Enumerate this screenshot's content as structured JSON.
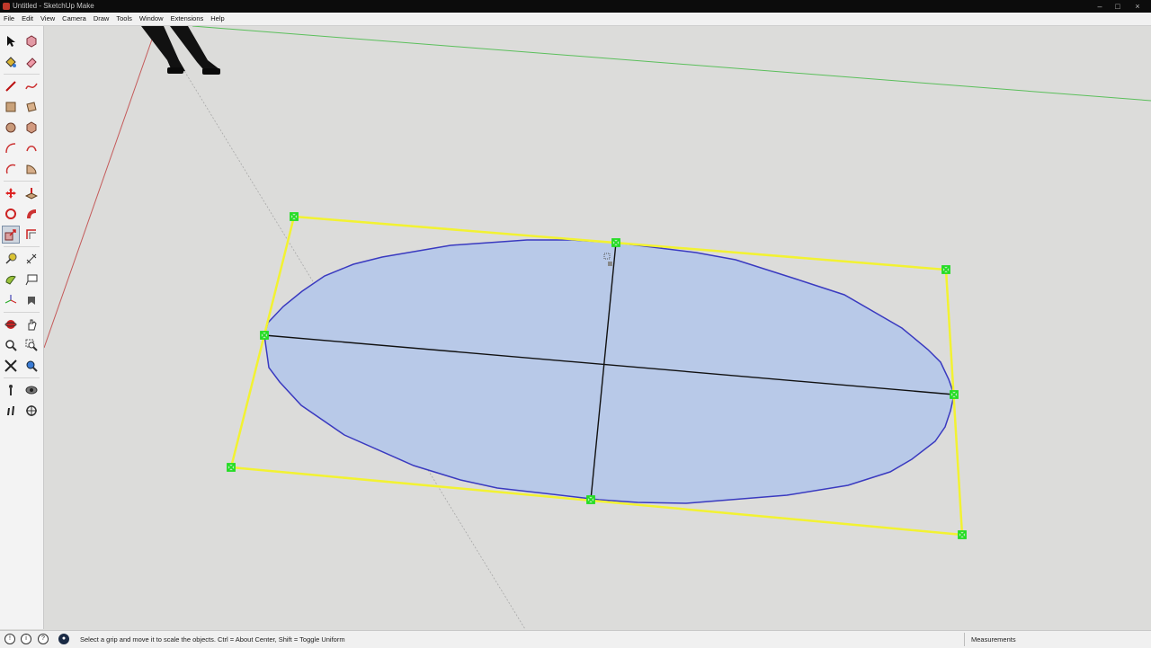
{
  "window": {
    "title": "Untitled - SketchUp Make"
  },
  "menu": {
    "items": [
      "File",
      "Edit",
      "View",
      "Camera",
      "Draw",
      "Tools",
      "Window",
      "Extensions",
      "Help"
    ]
  },
  "tools": [
    "select-tool-icon",
    "make-component-icon",
    "paint-bucket-icon",
    "eraser-icon",
    "line-tool-icon",
    "freehand-icon",
    "rectangle-icon",
    "rotated-rectangle-icon",
    "circle-icon",
    "polygon-icon",
    "arc-icon",
    "two-point-arc-icon",
    "three-point-arc-icon",
    "pie-icon",
    "move-icon",
    "push-pull-icon",
    "rotate-icon",
    "follow-me-icon",
    "scale-icon",
    "offset-icon",
    "tape-measure-icon",
    "dimension-icon",
    "protractor-icon",
    "text-tool-icon",
    "axes-icon",
    "3d-text-icon",
    "orbit-icon",
    "pan-icon",
    "zoom-icon",
    "zoom-window-icon",
    "zoom-extents-icon",
    "previous-view-icon",
    "position-camera-icon",
    "look-around-icon",
    "walk-icon",
    "section-plane-icon"
  ],
  "colors": {
    "selection_box": "#f2f232",
    "ellipse_fill": "#b8c9e8",
    "ellipse_edge": "#3a3ac0",
    "grip": "#22dd22",
    "green_axis": "#4fbf4f",
    "red_axis": "#c05050",
    "background": "#dcdcda"
  },
  "status": {
    "message": "Select a grip and move it to scale the objects. Ctrl = About Center, Shift = Toggle Uniform",
    "measurements_label": "Measurements",
    "icons": [
      "info-icon",
      "credits-icon",
      "help-icon",
      "geo-location-icon"
    ]
  }
}
